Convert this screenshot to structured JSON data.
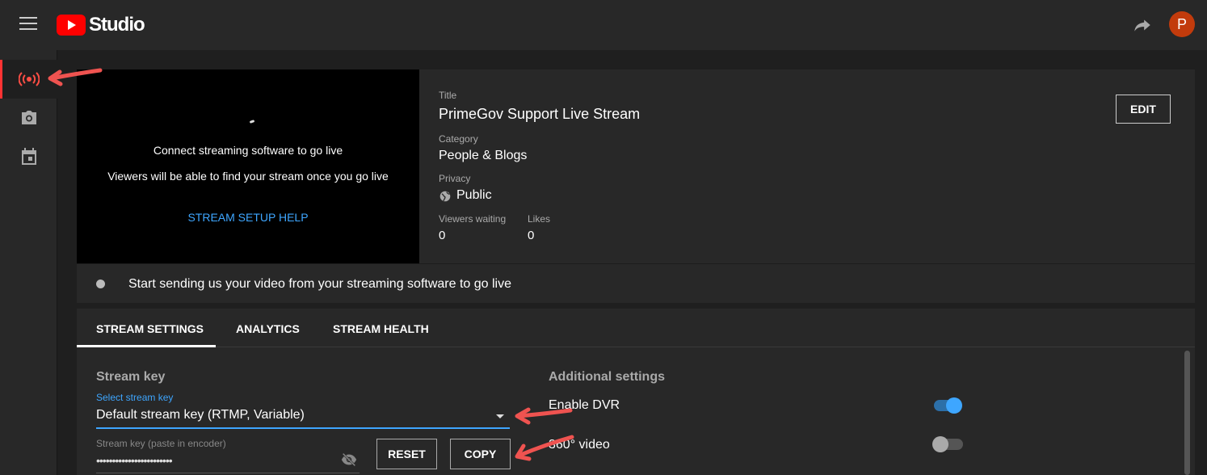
{
  "header": {
    "app_name": "Studio",
    "avatar_letter": "P",
    "icons": [
      "menu-icon",
      "youtube-logo",
      "share-icon"
    ]
  },
  "sidebar": {
    "items": [
      {
        "icon": "live-stream-icon",
        "active": true
      },
      {
        "icon": "camera-icon",
        "active": false
      },
      {
        "icon": "calendar-icon",
        "active": false
      }
    ]
  },
  "preview": {
    "connect_text": "Connect streaming software to go live",
    "viewers_note": "Viewers will be able to find your stream once you go live",
    "setup_help": "STREAM SETUP HELP"
  },
  "info": {
    "title_label": "Title",
    "title_value": "PrimeGov Support Live Stream",
    "category_label": "Category",
    "category_value": "People & Blogs",
    "privacy_label": "Privacy",
    "privacy_value": "Public",
    "viewers_waiting_label": "Viewers waiting",
    "viewers_waiting_value": "0",
    "likes_label": "Likes",
    "likes_value": "0",
    "edit_label": "EDIT"
  },
  "status": {
    "message": "Start sending us your video from your streaming software to go live"
  },
  "tabs": [
    {
      "label": "STREAM SETTINGS",
      "active": true
    },
    {
      "label": "ANALYTICS",
      "active": false
    },
    {
      "label": "STREAM HEALTH",
      "active": false
    }
  ],
  "stream_key": {
    "section_title": "Stream key",
    "select_label": "Select stream key",
    "select_value": "Default stream key (RTMP, Variable)",
    "key_label": "Stream key (paste in encoder)",
    "key_value": "••••••••••••••••••••••••",
    "reset_label": "RESET",
    "copy_label": "COPY"
  },
  "additional": {
    "section_title": "Additional settings",
    "settings": [
      {
        "label": "Enable DVR",
        "enabled": true
      },
      {
        "label": "360° video",
        "enabled": false
      }
    ]
  },
  "colors": {
    "accent": "#3ea6ff",
    "annotation_arrow": "#ef5350",
    "brand_red": "#ff0000",
    "avatar": "#c23b0c"
  }
}
